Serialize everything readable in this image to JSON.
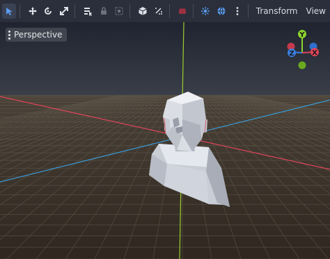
{
  "toolbar": {
    "tools": [
      {
        "icon": "select-arrow-icon",
        "active": true
      },
      {
        "icon": "move-icon"
      },
      {
        "icon": "rotate-icon"
      },
      {
        "icon": "scale-icon"
      },
      {
        "icon": "list-select-icon"
      },
      {
        "icon": "lock-icon"
      },
      {
        "icon": "group-icon"
      },
      {
        "icon": "cube-icon"
      },
      {
        "icon": "snap-icon"
      },
      {
        "icon": "camera-icon"
      },
      {
        "icon": "sun-icon"
      },
      {
        "icon": "globe-icon"
      },
      {
        "icon": "more-vertical-icon"
      }
    ],
    "transform_label": "Transform",
    "view_label": "View"
  },
  "viewport": {
    "perspective_label": "Perspective",
    "gizmo": {
      "y_label": "Y",
      "z_label": "Z",
      "x_label": "X"
    }
  },
  "colors": {
    "accent": "#5a9cf0",
    "x_axis": "#e0445a",
    "y_axis": "#8cd42e",
    "z_axis": "#3a80e0",
    "ground": "#3a3128",
    "sky": "#1f2430"
  }
}
